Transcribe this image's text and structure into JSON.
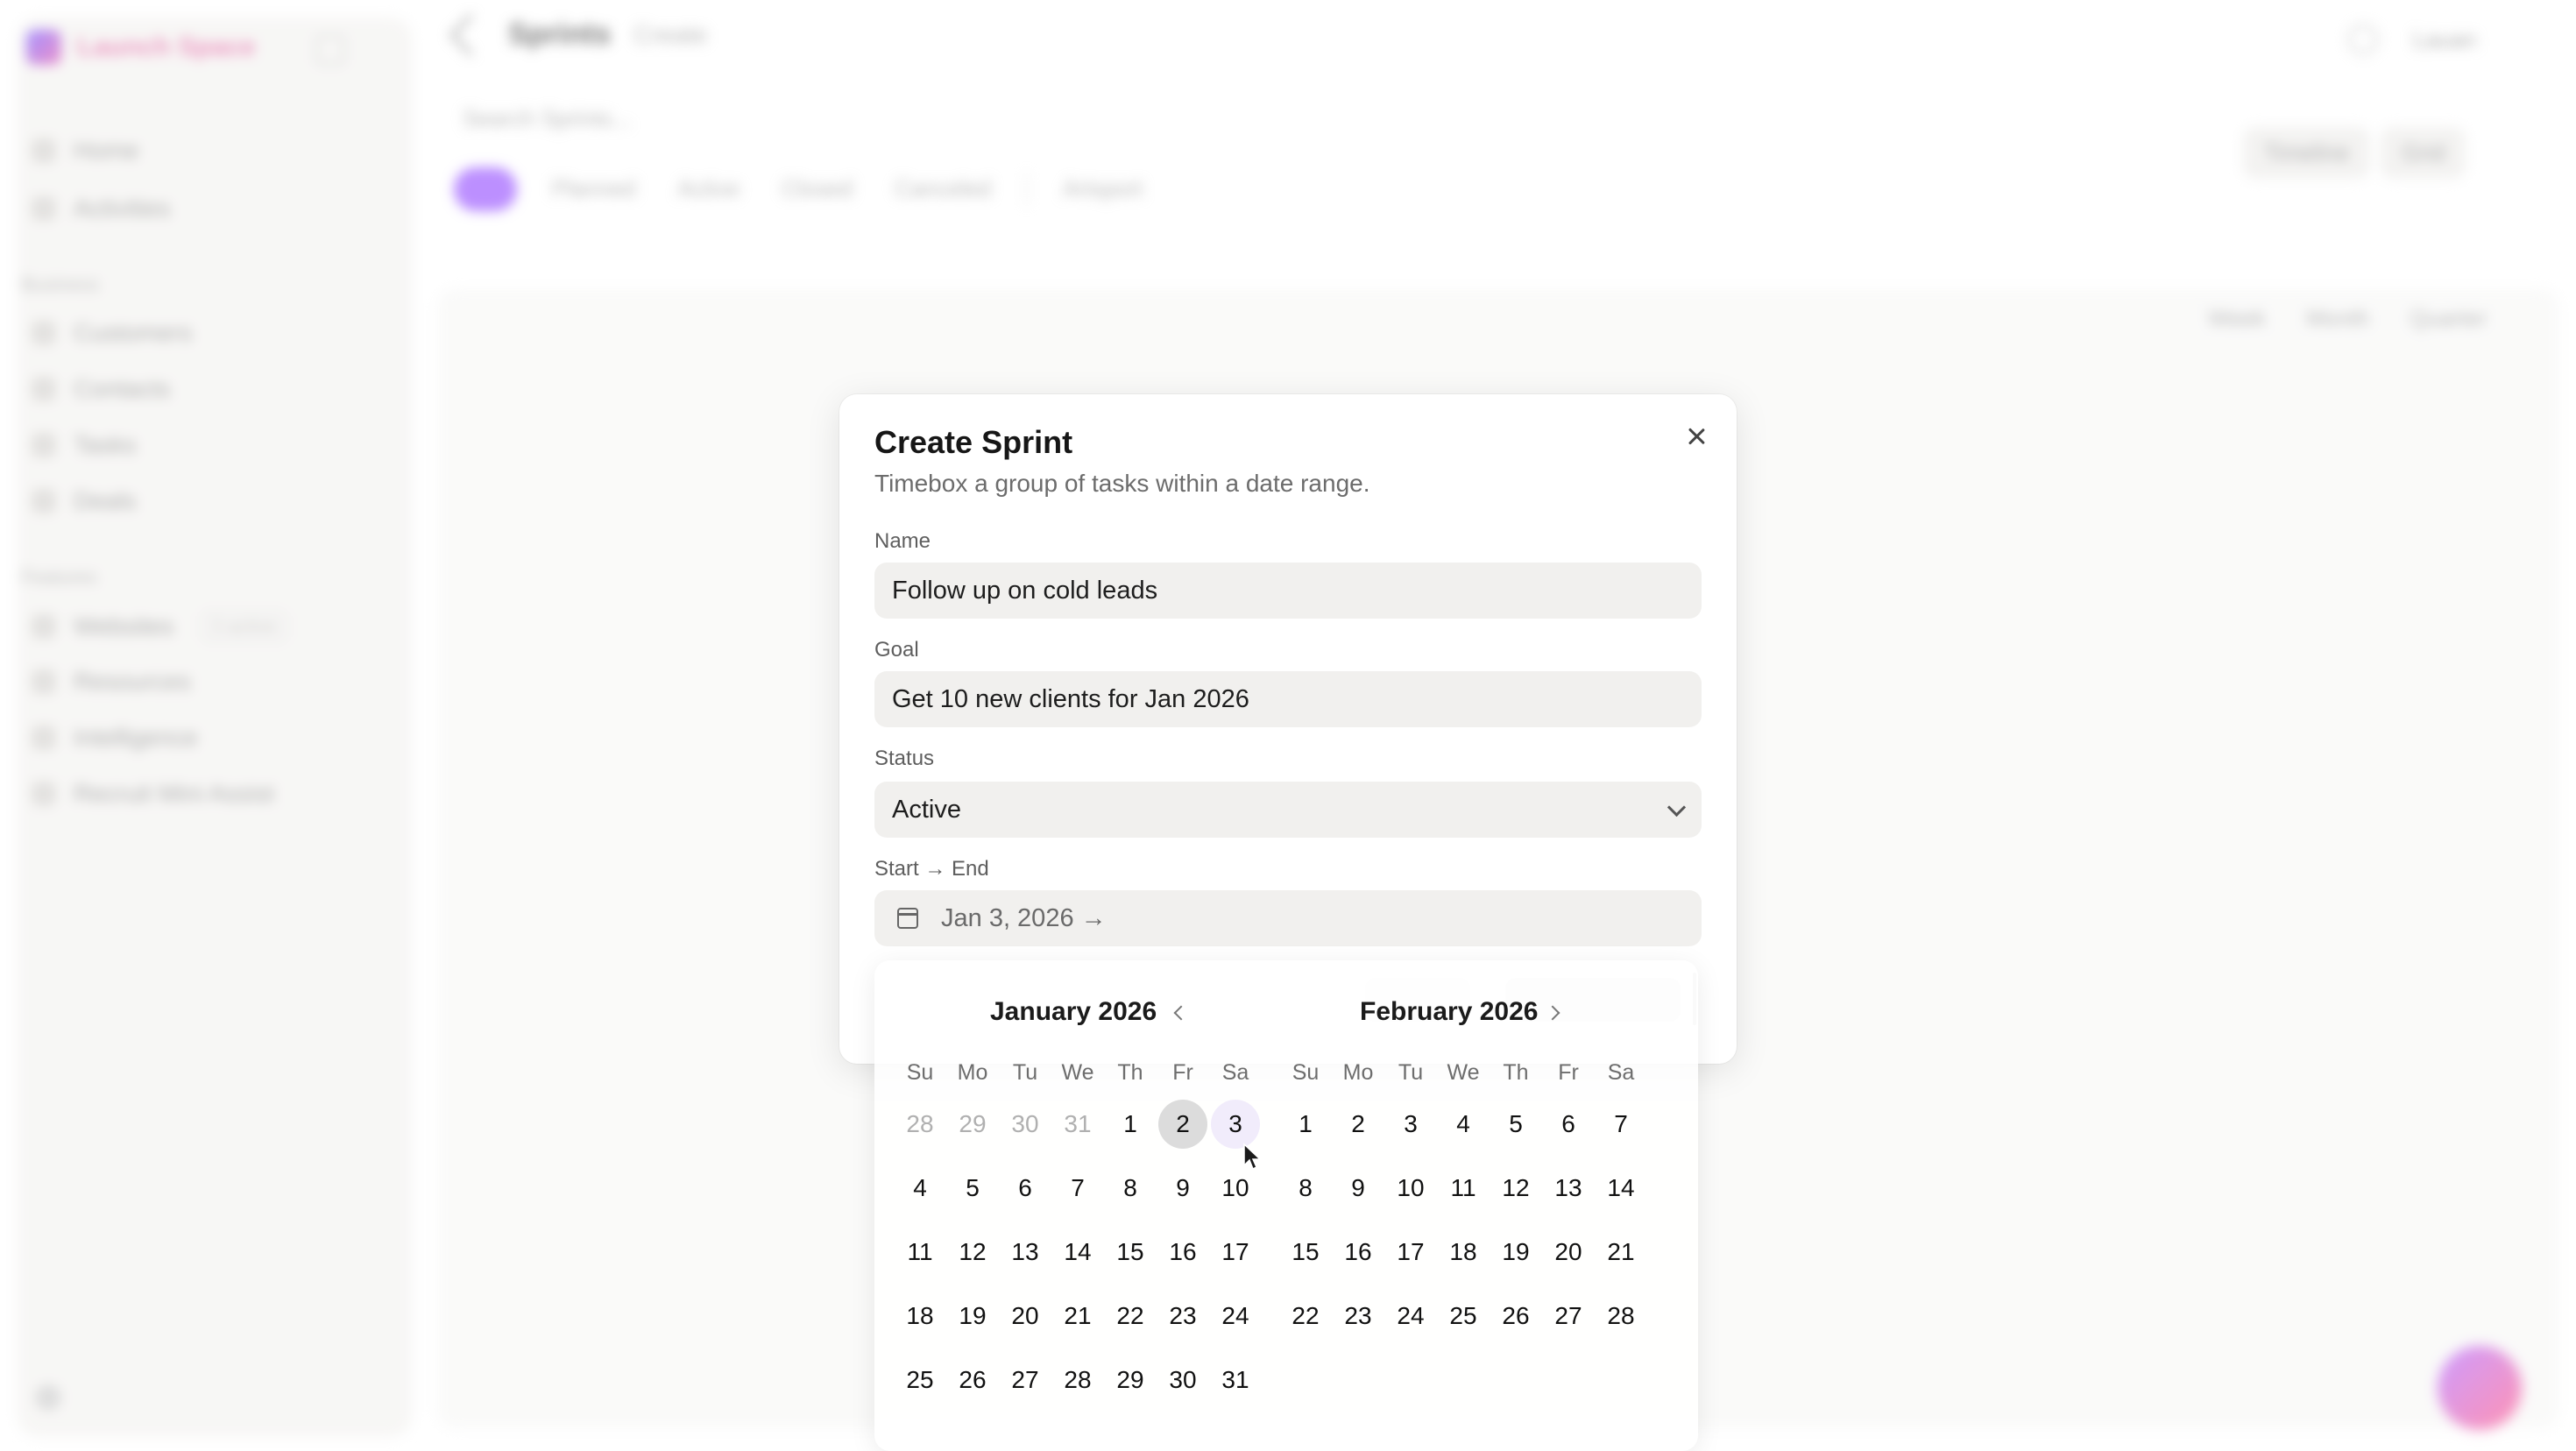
{
  "app": {
    "brand_name": "Launch Space",
    "page_title": "Sprints",
    "breadcrumb": "Create",
    "user_label": "Lauan",
    "search_placeholder": "Search Sprints..."
  },
  "sidebar": {
    "top_items": [
      "Home",
      "Activities"
    ],
    "section_1": "Business",
    "business_items": [
      "Customers",
      "Contacts",
      "Tasks",
      "Deals"
    ],
    "section_2": "Features",
    "feature_items": [
      {
        "label": "Websites",
        "badge": "3 active"
      },
      {
        "label": "Resources",
        "badge": ""
      },
      {
        "label": "Intelligence",
        "badge": ""
      },
      {
        "label": "Recruit Mini Assist",
        "badge": ""
      }
    ]
  },
  "toolbar": {
    "filters": [
      "Planned",
      "Active",
      "Closed",
      "Canceled"
    ],
    "archive_label": "Artsport",
    "views": [
      "Timeline",
      "Grid"
    ],
    "ranges": [
      "Week",
      "Month",
      "Quarter"
    ]
  },
  "modal": {
    "title": "Create Sprint",
    "description": "Timebox a group of tasks within a date range.",
    "name_label": "Name",
    "name_value": "Follow up on cold leads",
    "goal_label": "Goal",
    "goal_value": "Get 10 new clients for Jan 2026",
    "status_label": "Status",
    "status_value": "Active",
    "dates_label": "Start → End",
    "dates_value": "Jan 3, 2026 →"
  },
  "calendar": {
    "weekdays": [
      "Su",
      "Mo",
      "Tu",
      "We",
      "Th",
      "Fr",
      "Sa"
    ],
    "months": [
      {
        "title": "January 2026",
        "days": [
          "28",
          "29",
          "30",
          "31",
          "1",
          "2",
          "3",
          "4",
          "5",
          "6",
          "7",
          "8",
          "9",
          "10",
          "11",
          "12",
          "13",
          "14",
          "15",
          "16",
          "17",
          "18",
          "19",
          "20",
          "21",
          "22",
          "23",
          "24",
          "25",
          "26",
          "27",
          "28",
          "29",
          "30",
          "31"
        ],
        "outside_count": 4,
        "today": "2",
        "selected": "3"
      },
      {
        "title": "February 2026",
        "days": [
          "1",
          "2",
          "3",
          "4",
          "5",
          "6",
          "7",
          "8",
          "9",
          "10",
          "11",
          "12",
          "13",
          "14",
          "15",
          "16",
          "17",
          "18",
          "19",
          "20",
          "21",
          "22",
          "23",
          "24",
          "25",
          "26",
          "27",
          "28"
        ],
        "outside_count": 0,
        "today": "",
        "selected": ""
      }
    ]
  },
  "colors": {
    "accent_purple": "#9d5bff",
    "selected_day_bg": "#f1ecfb",
    "today_day_bg": "#dcdcdc"
  }
}
